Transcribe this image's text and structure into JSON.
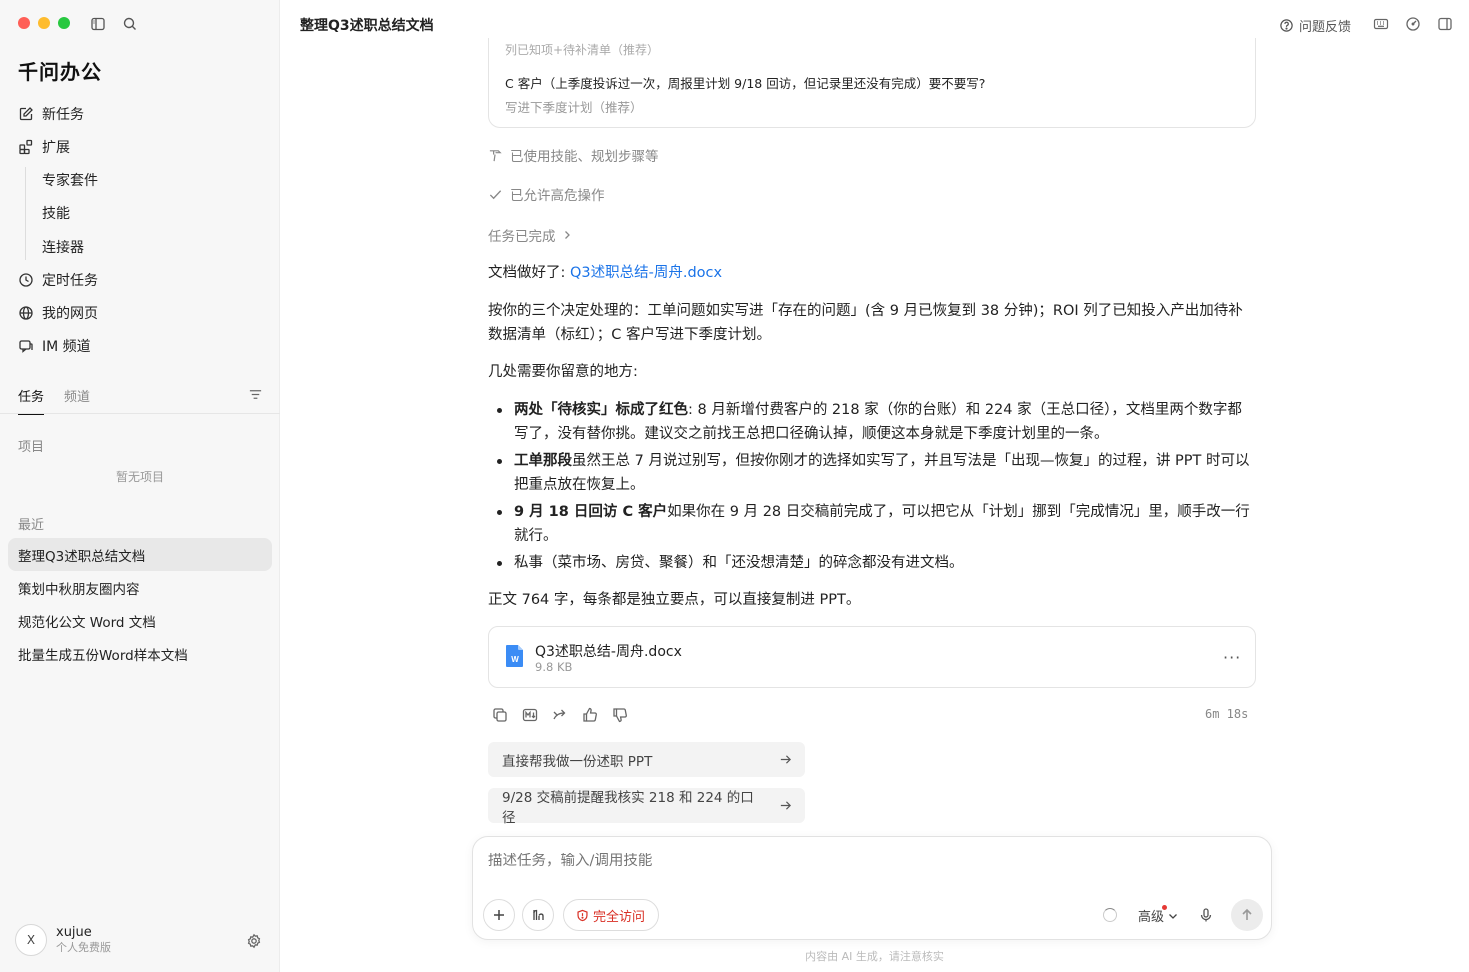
{
  "app": {
    "name": "千问办公"
  },
  "sidebar": {
    "nav": [
      {
        "label": "新任务",
        "icon": "edit-icon"
      },
      {
        "label": "扩展",
        "icon": "extensions-icon"
      }
    ],
    "subnav": [
      {
        "label": "专家套件"
      },
      {
        "label": "技能"
      },
      {
        "label": "连接器"
      }
    ],
    "nav2": [
      {
        "label": "定时任务",
        "icon": "clock-icon"
      },
      {
        "label": "我的网页",
        "icon": "globe-icon"
      },
      {
        "label": "IM 频道",
        "icon": "chat-icon"
      }
    ],
    "tabs": [
      {
        "label": "任务",
        "active": true
      },
      {
        "label": "频道",
        "active": false
      }
    ],
    "projects_label": "项目",
    "projects_empty": "暂无项目",
    "recent_label": "最近",
    "recent": [
      {
        "label": "整理Q3述职总结文档",
        "active": true
      },
      {
        "label": "策划中秋朋友圈内容",
        "active": false
      },
      {
        "label": "规范化公文 Word 文档",
        "active": false
      },
      {
        "label": "批量生成五份Word样本文档",
        "active": false
      }
    ],
    "user": {
      "initial": "X",
      "name": "xujue",
      "plan": "个人免费版"
    }
  },
  "header": {
    "title": "整理Q3述职总结文档",
    "feedback": "问题反馈"
  },
  "question_card": {
    "faded_text": "列已知项+待补清单（推荐）",
    "question": "C 客户（上季度投诉过一次，周报里计划 9/18 回访，但记录里还没有完成）要不要写?",
    "answer": "写进下季度计划（推荐）"
  },
  "steps": [
    {
      "label": "已使用技能、规划步骤等",
      "icon": "hammer-icon"
    },
    {
      "label": "已允许高危操作",
      "icon": "check-icon"
    }
  ],
  "task_done": "任务已完成",
  "message": {
    "doc_ready_prefix": "文档做好了:",
    "doc_link": "Q3述职总结-周舟.docx",
    "para1": "按你的三个决定处理的：工单问题如实写进「存在的问题」(含 9 月已恢复到 38 分钟)；ROI 列了已知投入产出加待补数据清单（标红）；C 客户写进下季度计划。",
    "para2": "几处需要你留意的地方:",
    "bullets": [
      {
        "bold": "两处「待核实」标成了红色",
        "text": ": 8 月新增付费客户的 218 家（你的台账）和 224 家（王总口径），文档里两个数字都写了，没有替你挑。建议交之前找王总把口径确认掉，顺便这本身就是下季度计划里的一条。"
      },
      {
        "bold": "工单那段",
        "text": "虽然王总 7 月说过别写，但按你刚才的选择如实写了，并且写法是「出现—恢复」的过程，讲 PPT 时可以把重点放在恢复上。"
      },
      {
        "bold": "9 月 18 日回访 C 客户",
        "text": "如果你在 9 月 28 日交稿前完成了，可以把它从「计划」挪到「完成情况」里，顺手改一行就行。"
      },
      {
        "bold": "",
        "text": "私事（菜市场、房贷、聚餐）和「还没想清楚」的碎念都没有进文档。"
      }
    ],
    "para3": "正文 764 字，每条都是独立要点，可以直接复制进 PPT。"
  },
  "file": {
    "name": "Q3述职总结-周舟.docx",
    "size": "9.8 KB",
    "icon": "word-file-icon"
  },
  "actions": {
    "icons": [
      "copy-icon",
      "markdown-icon",
      "share-icon",
      "thumbs-up-icon",
      "thumbs-down-icon"
    ],
    "elapsed": "6m 18s"
  },
  "suggestions": [
    {
      "label": "直接帮我做一份述职 PPT"
    },
    {
      "label": "9/28 交稿前提醒我核实 218 和 224 的口径"
    }
  ],
  "composer": {
    "placeholder": "描述任务，输入/调用技能",
    "access": "完全访问",
    "level": "高级"
  },
  "disclaimer": "内容由 AI 生成，请注意核实",
  "colors": {
    "link": "#1a73e8",
    "danger": "#d93025",
    "active_bg": "#e8e8e8"
  }
}
